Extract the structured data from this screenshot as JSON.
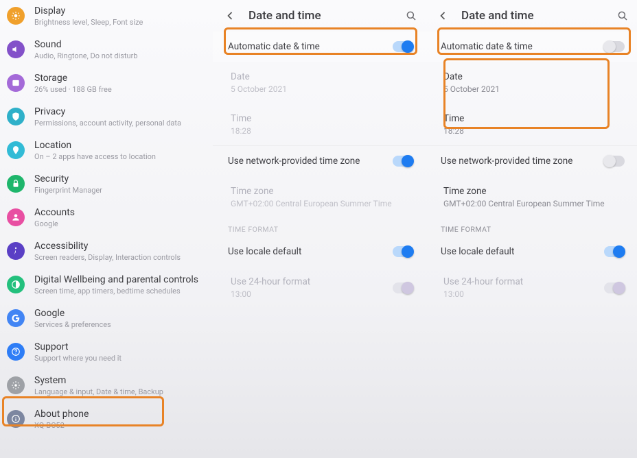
{
  "panel1": {
    "rows": [
      {
        "id": "display",
        "title": "Display",
        "sub": "Brightness level, Sleep, Font size",
        "color": "c-orange"
      },
      {
        "id": "sound",
        "title": "Sound",
        "sub": "Audio, Ringtone, Do not disturb",
        "color": "c-purple"
      },
      {
        "id": "storage",
        "title": "Storage",
        "sub": "26% used · 188 GB free",
        "color": "c-violet"
      },
      {
        "id": "privacy",
        "title": "Privacy",
        "sub": "Permissions, account activity, personal data",
        "color": "c-teal"
      },
      {
        "id": "location",
        "title": "Location",
        "sub": "On – 2 apps have access to location",
        "color": "c-cyan"
      },
      {
        "id": "security",
        "title": "Security",
        "sub": "Fingerprint Manager",
        "color": "c-green"
      },
      {
        "id": "accounts",
        "title": "Accounts",
        "sub": "Google",
        "color": "c-pink"
      },
      {
        "id": "accessibility",
        "title": "Accessibility",
        "sub": "Screen readers, Display, Interaction controls",
        "color": "c-indigo"
      },
      {
        "id": "wellbeing",
        "title": "Digital Wellbeing and parental controls",
        "sub": "Screen time, app timers, bedtime schedules",
        "color": "c-green2"
      },
      {
        "id": "google",
        "title": "Google",
        "sub": "Services & preferences",
        "color": "c-gblue"
      },
      {
        "id": "support",
        "title": "Support",
        "sub": "Support where you need it",
        "color": "c-blue"
      },
      {
        "id": "system",
        "title": "System",
        "sub": "Language & input, Date & time, Backup",
        "color": "c-grey"
      },
      {
        "id": "about",
        "title": "About phone",
        "sub": "XQ-BC52",
        "color": "c-steel"
      }
    ]
  },
  "dt": {
    "heading": "Date and time",
    "auto_label": "Automatic date & time",
    "date_label": "Date",
    "date_value": "5 October 2021",
    "time_label": "Time",
    "time_value": "18:28",
    "net_tz_label": "Use network-provided time zone",
    "tz_label": "Time zone",
    "tz_value": "GMT+02:00 Central European Summer Time",
    "section_tf": "TIME FORMAT",
    "locale_label": "Use locale default",
    "h24_label": "Use 24-hour format",
    "h24_value": "13:00"
  }
}
